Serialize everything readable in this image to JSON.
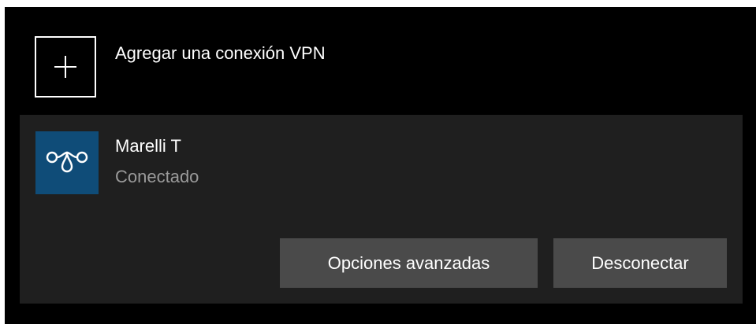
{
  "add_vpn": {
    "icon": "plus-icon",
    "label": "Agregar una conexión VPN"
  },
  "connection": {
    "icon": "vpn-logo-icon",
    "name": "Marelli T",
    "status": "Conectado",
    "buttons": {
      "advanced_label": "Opciones avanzadas",
      "disconnect_label": "Desconectar"
    }
  },
  "colors": {
    "background": "#000000",
    "card_background": "#1f1f1f",
    "button_background": "#4a4a4a",
    "logo_background": "#0f4c78",
    "primary_text": "#ffffff",
    "secondary_text": "#9a9a9a"
  }
}
